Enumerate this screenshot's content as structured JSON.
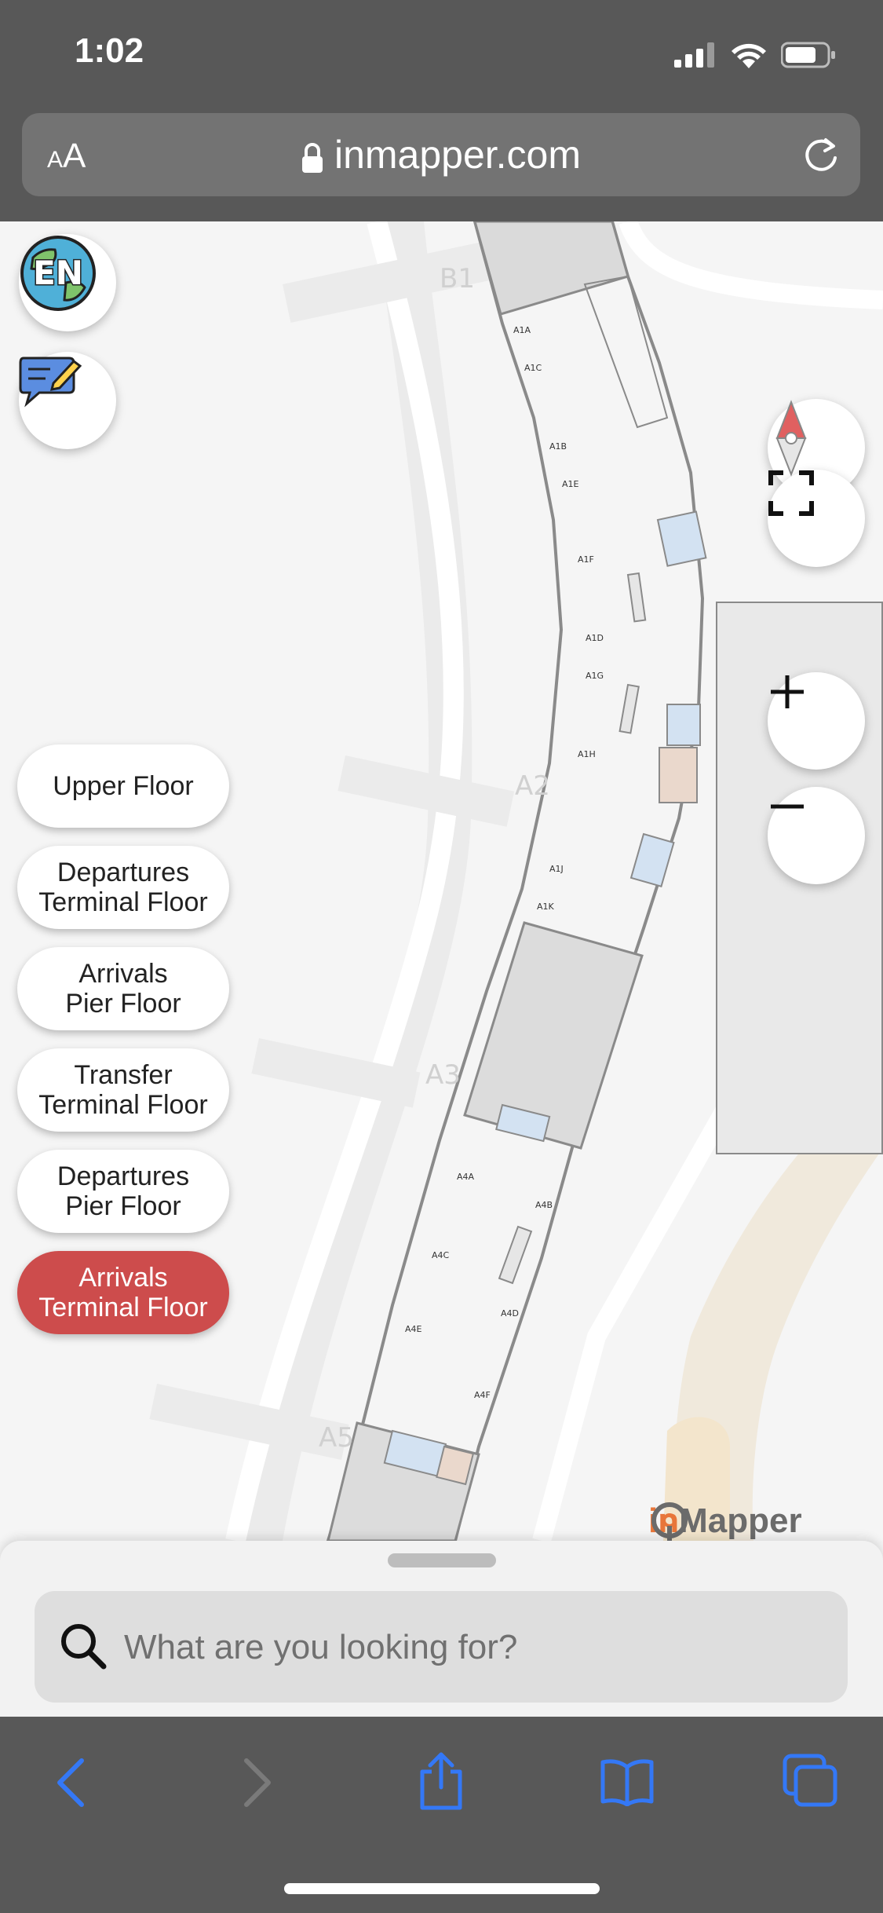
{
  "status_bar": {
    "time": "1:02"
  },
  "browser": {
    "text_size_label_small": "A",
    "text_size_label_large": "A",
    "url": "inmapper.com"
  },
  "map": {
    "language_button": "EN",
    "zone_labels": [
      "B1",
      "A2",
      "A3",
      "A5"
    ],
    "gate_labels": [
      "A1A",
      "A1C",
      "A1B",
      "A1E",
      "A1F",
      "A1D",
      "A1G",
      "A1H",
      "A1J",
      "A1K",
      "A4A",
      "A4B",
      "A4C",
      "A4D",
      "A4E",
      "A4F"
    ],
    "floors": [
      {
        "label": "Upper Floor",
        "active": false
      },
      {
        "label": "Departures\nTerminal Floor",
        "active": false
      },
      {
        "label": "Arrivals\nPier Floor",
        "active": false
      },
      {
        "label": "Transfer\nTerminal Floor",
        "active": false
      },
      {
        "label": "Departures\nPier Floor",
        "active": false
      },
      {
        "label": "Arrivals\nTerminal Floor",
        "active": true
      }
    ],
    "logo_in": "in",
    "logo_rest": "Mapper"
  },
  "search": {
    "placeholder": "What are you looking for?"
  },
  "colors": {
    "accent": "#cd4c4c",
    "ios_blue": "#3478f6",
    "logo_orange": "#e8763a",
    "logo_gray": "#6b6b6b"
  }
}
